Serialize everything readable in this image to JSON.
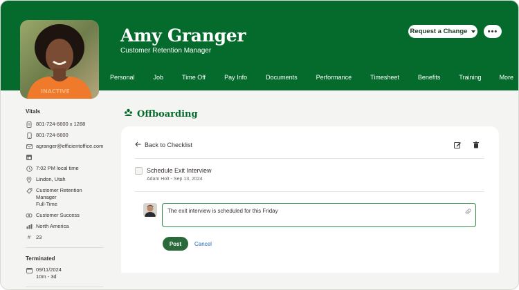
{
  "employee": {
    "name": "Amy Granger",
    "title": "Customer Retention Manager"
  },
  "header_actions": {
    "request_label": "Request a Change",
    "more_dots": "•••"
  },
  "tabs": [
    {
      "label": "Personal"
    },
    {
      "label": "Job"
    },
    {
      "label": "Time Off"
    },
    {
      "label": "Pay Info"
    },
    {
      "label": "Documents"
    },
    {
      "label": "Performance"
    },
    {
      "label": "Timesheet"
    },
    {
      "label": "Benefits"
    },
    {
      "label": "Training"
    },
    {
      "label": "More"
    }
  ],
  "vitals": {
    "title": "Vitals",
    "work_phone": "801-724-6600 x 1288",
    "mobile_phone": "801-724-6600",
    "email": "agranger@efficientoffice.com",
    "local_time": "7:02 PM local time",
    "location": "Lindon, Utah",
    "job_title": "Customer Retention Manager",
    "employment_type": "Full-Time",
    "department": "Customer Success",
    "division": "North America",
    "employee_number": "23"
  },
  "terminated": {
    "title": "Terminated",
    "date": "09/11/2024",
    "duration": "10m - 3d"
  },
  "main": {
    "section_title": "Offboarding",
    "back_label": "Back to Checklist",
    "task": {
      "title": "Schedule Exit Interview",
      "meta": "Adam Holt - Sep 13, 2024"
    },
    "comment": {
      "value": "The exit interview is scheduled for this Friday"
    },
    "post_label": "Post",
    "cancel_label": "Cancel"
  },
  "colors": {
    "brand_green": "#046b2c",
    "post_button": "#2a6a3a",
    "link_blue": "#1e62b4"
  }
}
